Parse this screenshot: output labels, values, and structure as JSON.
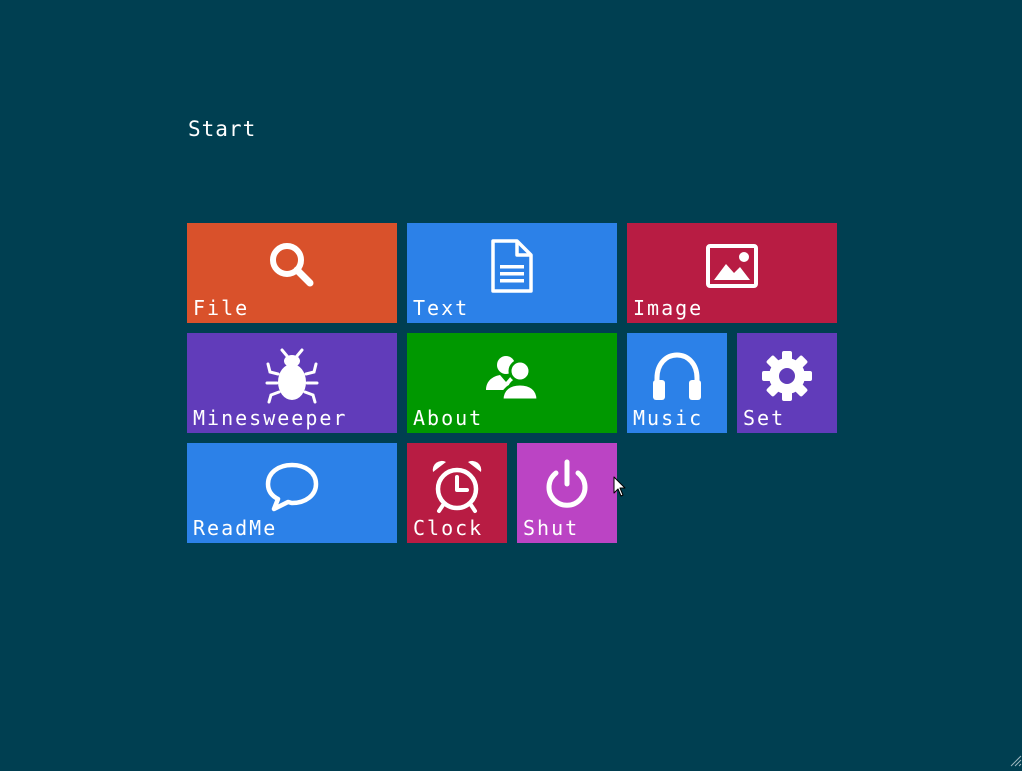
{
  "start": {
    "title": "Start"
  },
  "colors": {
    "background": "#003f51",
    "orange": "#d9512b",
    "blue": "#2c81e8",
    "crimson": "#b81c43",
    "purple": "#613cba",
    "green": "#009800",
    "magenta": "#bb44c4"
  },
  "tiles": {
    "file": {
      "label": "File",
      "icon": "search-icon",
      "color": "#d9512b"
    },
    "text": {
      "label": "Text",
      "icon": "document-icon",
      "color": "#2c81e8"
    },
    "image": {
      "label": "Image",
      "icon": "picture-icon",
      "color": "#b81c43"
    },
    "minesweeper": {
      "label": "Minesweeper",
      "icon": "bug-icon",
      "color": "#613cba"
    },
    "about": {
      "label": "About",
      "icon": "users-icon",
      "color": "#009800"
    },
    "music": {
      "label": "Music",
      "icon": "headphones-icon",
      "color": "#2c81e8"
    },
    "set": {
      "label": "Set",
      "icon": "gear-icon",
      "color": "#613cba"
    },
    "readme": {
      "label": "ReadMe",
      "icon": "speech-bubble-icon",
      "color": "#2c81e8"
    },
    "clock": {
      "label": "Clock",
      "icon": "alarm-clock-icon",
      "color": "#b81c43"
    },
    "shut": {
      "label": "Shut",
      "icon": "power-icon",
      "color": "#bb44c4"
    }
  }
}
